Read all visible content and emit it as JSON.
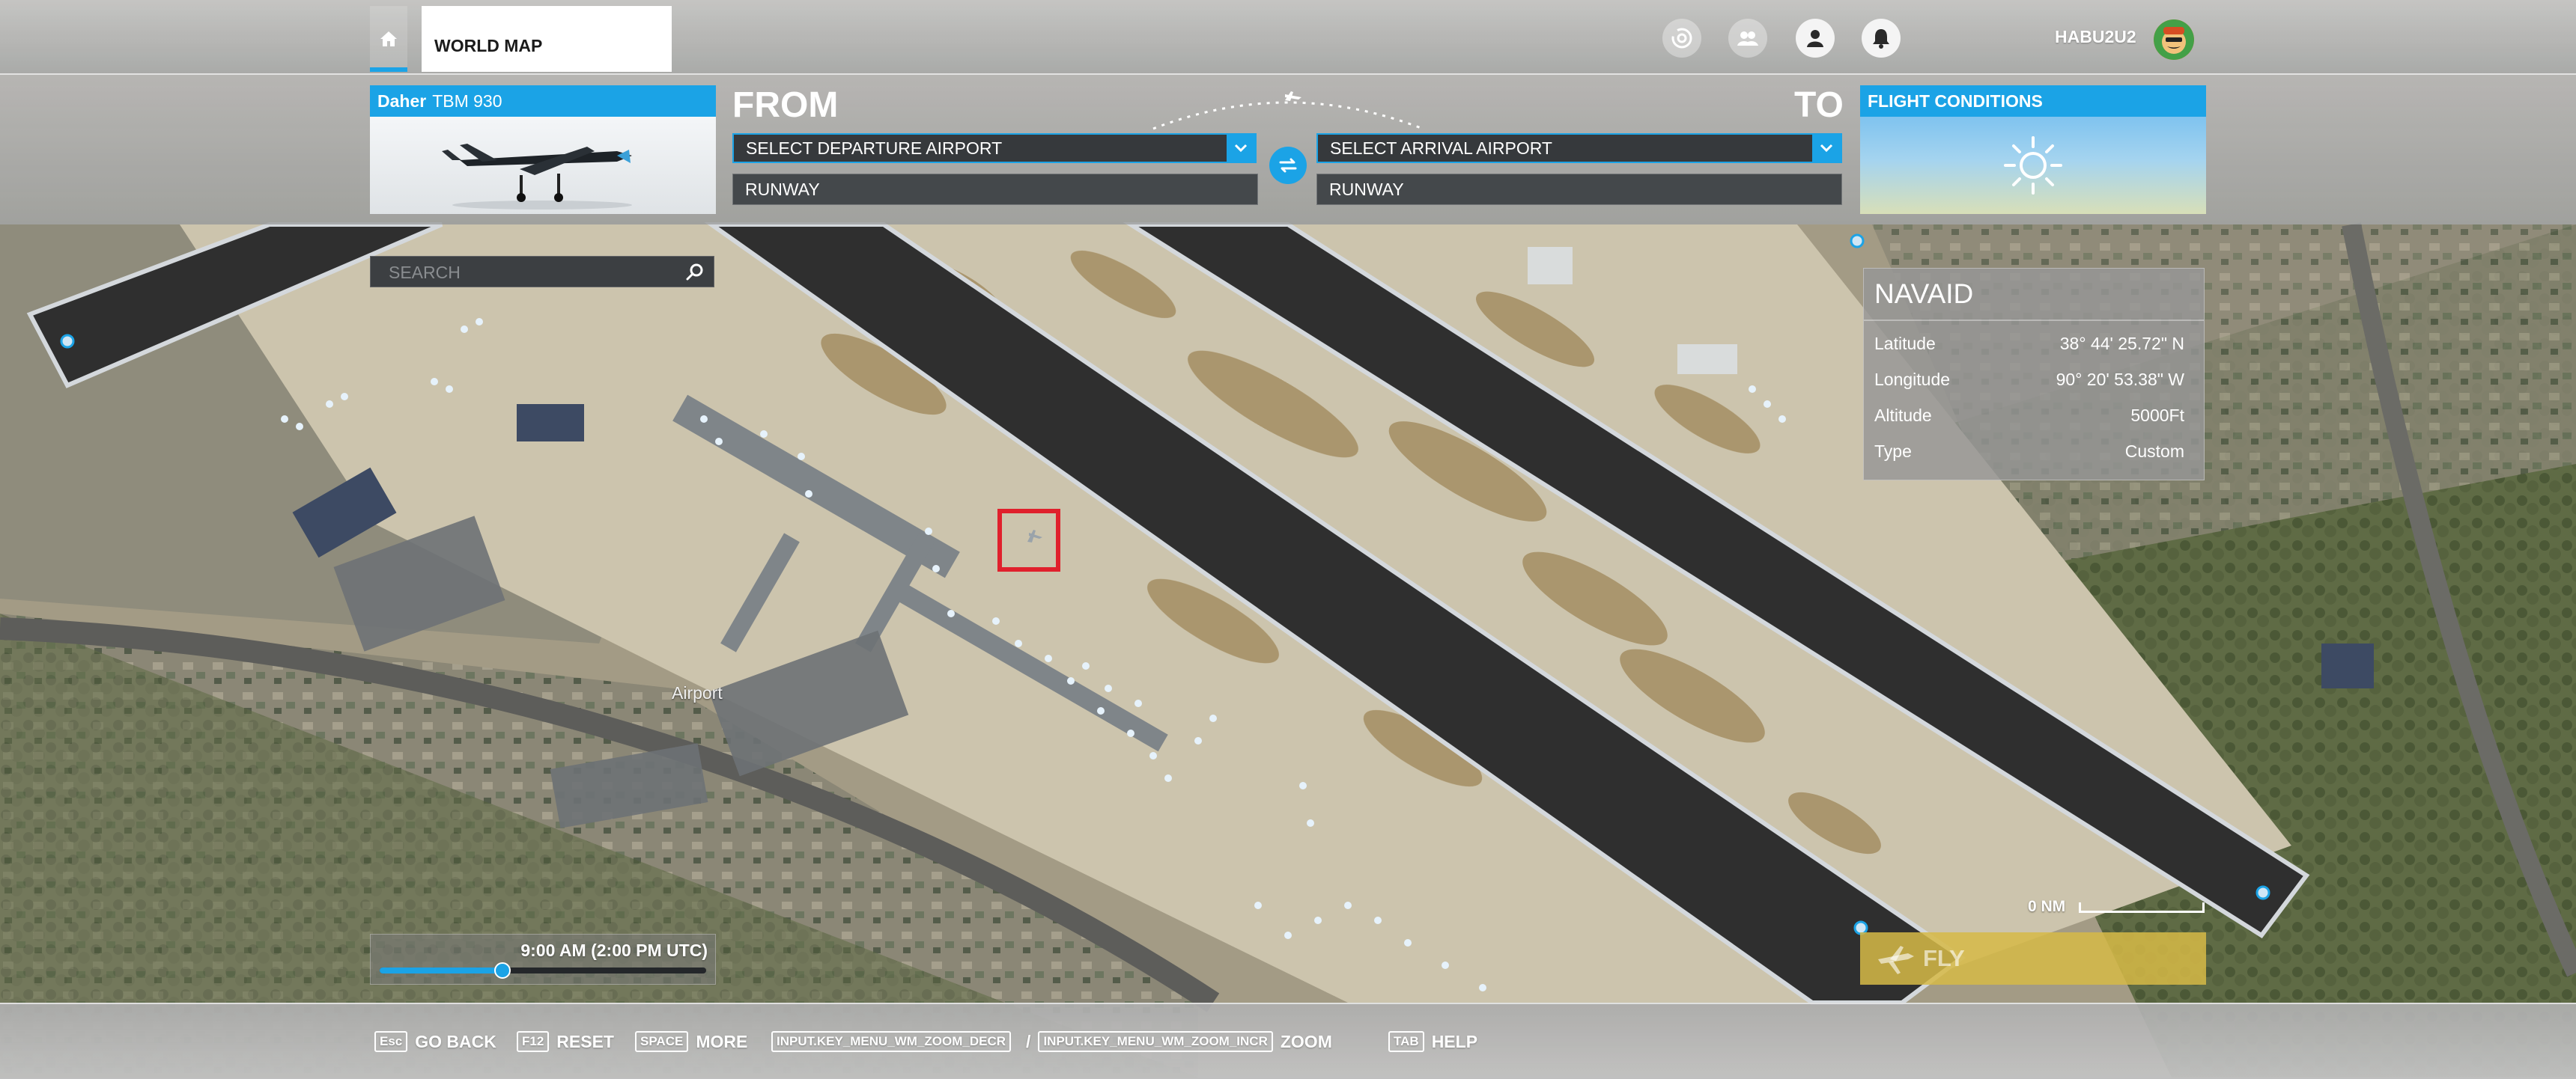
{
  "header": {
    "tab_world_map": "WORLD MAP",
    "username": "HABU2U2"
  },
  "aircraft": {
    "brand": "Daher",
    "model": "TBM 930"
  },
  "route": {
    "from_label": "FROM",
    "to_label": "TO",
    "departure_select": "SELECT DEPARTURE AIRPORT",
    "departure_runway": "RUNWAY",
    "arrival_select": "SELECT ARRIVAL AIRPORT",
    "arrival_runway": "RUNWAY"
  },
  "conditions": {
    "title": "FLIGHT CONDITIONS",
    "weather_icon": "sun-icon"
  },
  "search": {
    "placeholder": "SEARCH"
  },
  "navaid": {
    "title": "NAVAID",
    "rows": [
      {
        "label": "Latitude",
        "value": "38° 44' 25.72\" N"
      },
      {
        "label": "Longitude",
        "value": "90° 20' 53.38\" W"
      },
      {
        "label": "Altitude",
        "value": "5000Ft"
      },
      {
        "label": "Type",
        "value": "Custom"
      }
    ]
  },
  "map": {
    "airport_label": "Airport",
    "scale_label": "0 NM"
  },
  "time": {
    "display": "9:00 AM (2:00 PM UTC)",
    "slider_fraction": 0.375
  },
  "fly_button": "FLY",
  "footer": {
    "hints": [
      {
        "key": "Esc",
        "label": "GO BACK"
      },
      {
        "key": "F12",
        "label": "RESET"
      },
      {
        "key": "SPACE",
        "label": "MORE"
      },
      {
        "key": "INPUT.KEY_MENU_WM_ZOOM_DECR",
        "separator": "/",
        "key2": "INPUT.KEY_MENU_WM_ZOOM_INCR",
        "label": "ZOOM"
      },
      {
        "key": "TAB",
        "label": "HELP"
      }
    ]
  },
  "colors": {
    "accent": "#1ba3e6",
    "selection": "#e0202c",
    "fly": "#d6ba46"
  }
}
